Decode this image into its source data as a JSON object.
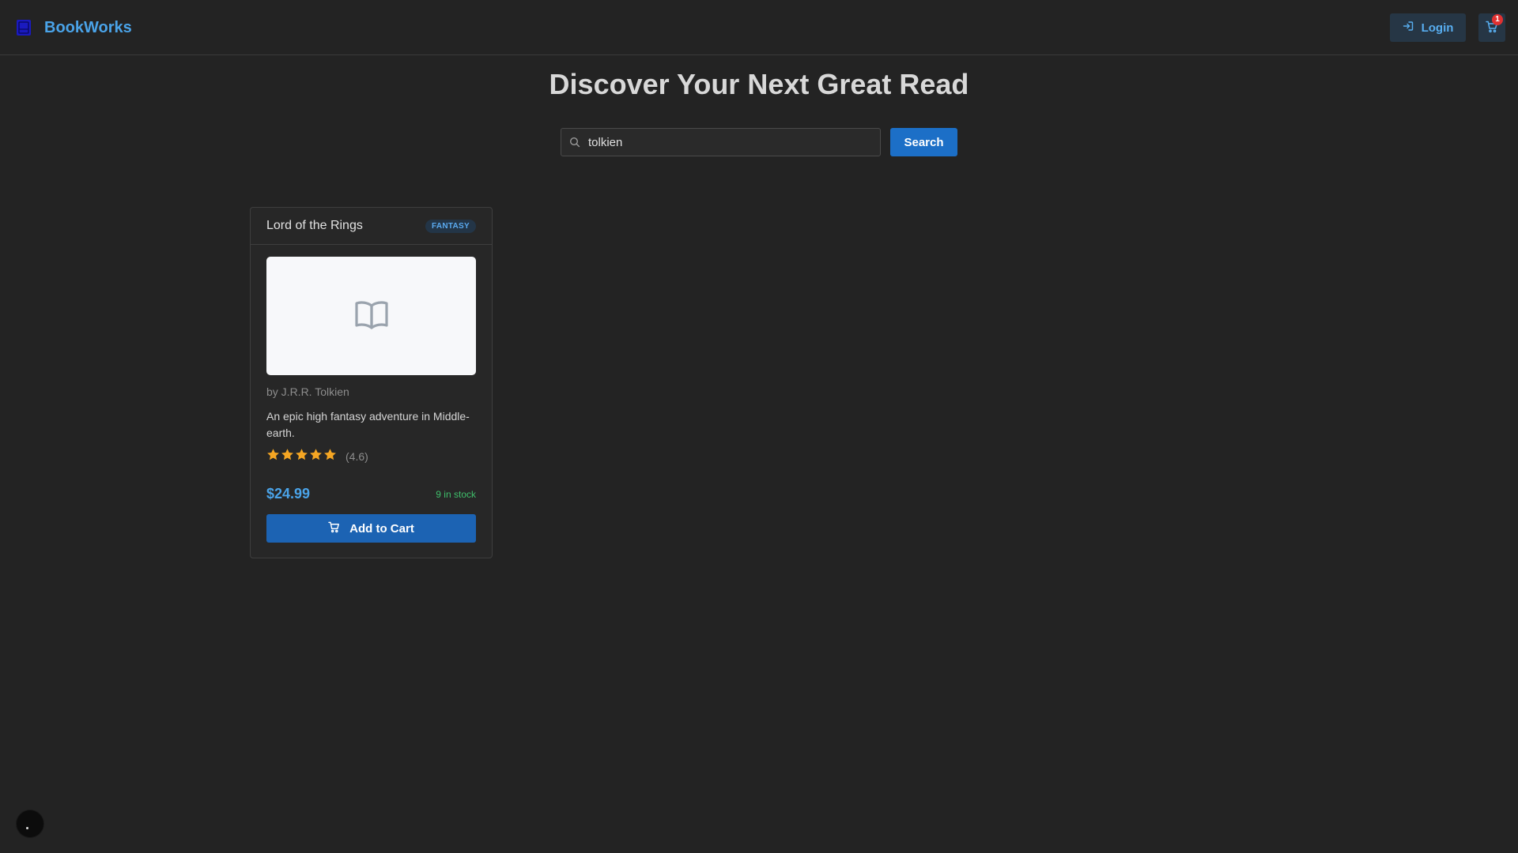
{
  "app": {
    "brand_name": "BookWorks",
    "brand_icon": "book-square-icon",
    "accent": "#4aa3e8"
  },
  "header": {
    "login_label": "Login",
    "login_icon": "sign-in-icon",
    "cart_icon": "cart-icon",
    "cart_count": "1"
  },
  "hero": {
    "title": "Discover Your Next Great Read"
  },
  "search": {
    "value": "tolkien",
    "button_label": "Search",
    "icon": "search-icon"
  },
  "books": [
    {
      "title": "Lord of the Rings",
      "genre": "FANTASY",
      "cover_icon": "open-book-icon",
      "author": "by J.R.R. Tolkien",
      "description": "An epic high fantasy adventure in Middle-earth.",
      "rating": 4.6,
      "rating_label": "(4.6)",
      "stars_filled": 5,
      "price": "$24.99",
      "stock": "9 in stock",
      "add_label": "Add to Cart"
    }
  ],
  "colors": {
    "background": "#232323",
    "primary_button": "#1c6fc7",
    "star": "#f5a623",
    "stock": "#3fbf6b",
    "badge": "#e03131"
  }
}
